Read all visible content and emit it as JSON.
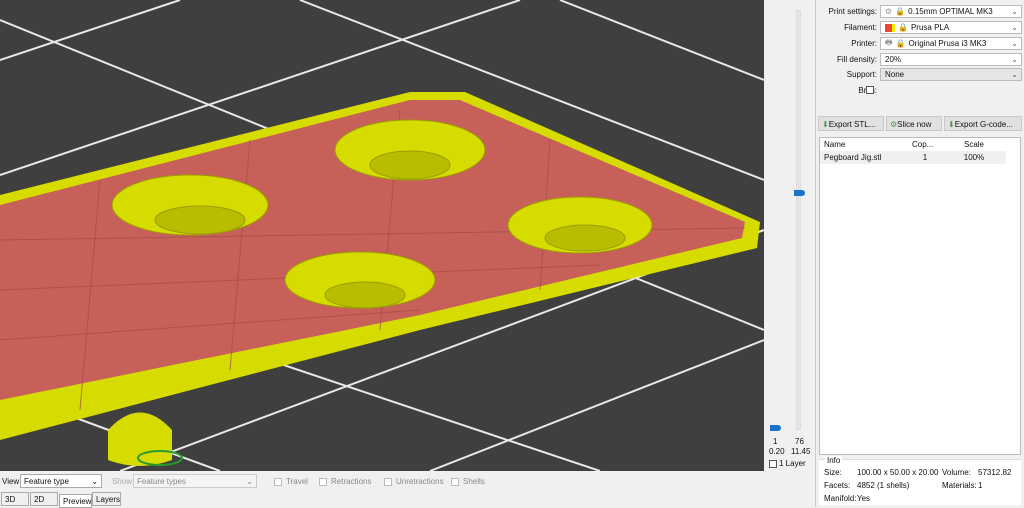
{
  "viewport": {
    "slider": {
      "bottom_layer": "1",
      "bottom_height": "0.20",
      "top_layer": "76",
      "top_height": "11.45",
      "one_layer_label": "1 Layer"
    }
  },
  "settings": {
    "print_settings_label": "Print settings:",
    "print_settings_value": "0.15mm OPTIMAL MK3",
    "filament_label": "Filament:",
    "filament_value": "Prusa PLA",
    "printer_label": "Printer:",
    "printer_value": "Original Prusa i3 MK3",
    "fill_density_label": "Fill density:",
    "fill_density_value": "20%",
    "support_label": "Support:",
    "support_value": "None",
    "brim_label": "Brim:"
  },
  "buttons": {
    "export_stl": "Export STL...",
    "slice_now": "Slice now",
    "export_gcode": "Export G-code..."
  },
  "objects": {
    "headers": [
      "Name",
      "Cop...",
      "Scale"
    ],
    "rows": [
      {
        "name": "Pegboard Jig.stl",
        "copies": "1",
        "scale": "100%"
      }
    ]
  },
  "info": {
    "title": "Info",
    "size_label": "Size:",
    "size": "100.00 x 50.00 x 20.00",
    "volume_label": "Volume:",
    "volume": "57312.82",
    "facets_label": "Facets:",
    "facets": "4852 (1 shells)",
    "materials_label": "Materials:",
    "materials": "1",
    "manifold_label": "Manifold:",
    "manifold": "Yes"
  },
  "bottom": {
    "view_label": "View",
    "view_value": "Feature type",
    "show_label": "Show",
    "show_value": "Feature types",
    "travel": "Travel",
    "retractions": "Retractions",
    "unretractions": "Unretractions",
    "shells": "Shells"
  },
  "tabs": [
    "3D",
    "2D",
    "Preview",
    "Layers"
  ],
  "colors": {
    "part_yellow": "#d6dc00",
    "infill_red": "#c8605a",
    "bed": "#3f3f3f",
    "slider_thumb": "#1a73c8"
  }
}
